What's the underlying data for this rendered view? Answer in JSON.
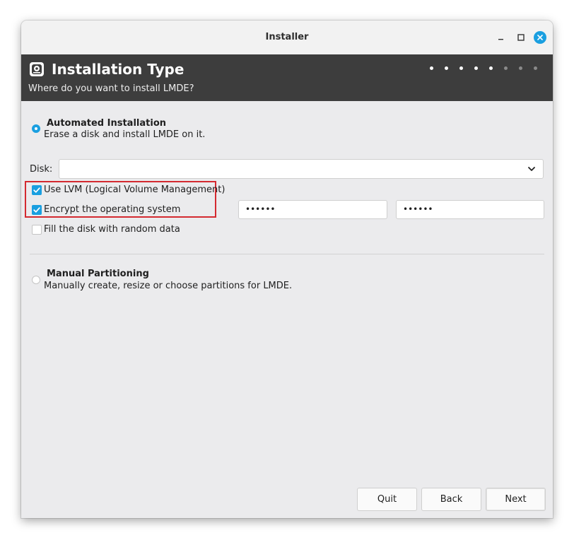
{
  "window": {
    "title": "Installer"
  },
  "header": {
    "title": "Installation Type",
    "subtitle": "Where do you want to install LMDE?",
    "logo_icon": "lmde-installer-icon",
    "progress": {
      "total_steps": 8,
      "completed_steps": 5
    }
  },
  "automated": {
    "title": "Automated Installation",
    "description": "Erase a disk and install LMDE on it.",
    "selected": true
  },
  "disk": {
    "label": "Disk:",
    "value": ""
  },
  "options": {
    "lvm_label": "Use LVM (Logical Volume Management)",
    "lvm_checked": true,
    "encrypt_label": "Encrypt the operating system",
    "encrypt_checked": true,
    "random_label": "Fill the disk with random data",
    "random_checked": false,
    "password_value": "••••••",
    "password_confirm_value": "••••••"
  },
  "manual": {
    "title": "Manual Partitioning",
    "description": "Manually create, resize or choose partitions for LMDE.",
    "selected": false
  },
  "buttons": {
    "quit": "Quit",
    "back": "Back",
    "next": "Next"
  },
  "colors": {
    "accent": "#1a9fe0",
    "header_bg": "#3d3d3d",
    "highlight_border": "#d42a30"
  }
}
